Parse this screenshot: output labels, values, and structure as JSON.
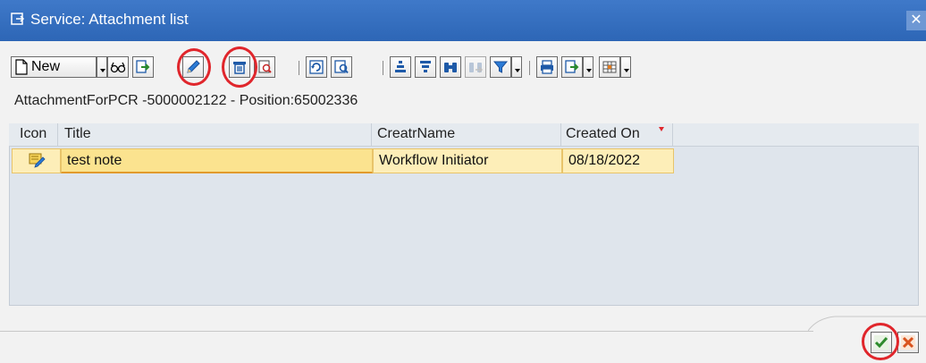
{
  "window": {
    "title": "Service: Attachment list",
    "close_icon": "close-icon"
  },
  "toolbar": {
    "new_label": "New",
    "buttons": [
      {
        "name": "new-button",
        "icon": "document-icon",
        "has_dropdown": true
      },
      {
        "name": "display-button",
        "icon": "glasses-icon"
      },
      {
        "name": "export-button",
        "icon": "export-icon"
      },
      {
        "name": "edit-button",
        "icon": "pencil-icon",
        "highlighted": true
      },
      {
        "name": "delete-button",
        "icon": "trash-icon",
        "highlighted": true
      },
      {
        "name": "details-button",
        "icon": "magnify-document-icon"
      },
      {
        "name": "refresh-button",
        "icon": "refresh-icon"
      },
      {
        "name": "select-layout-button",
        "icon": "find-icon"
      },
      {
        "name": "sort-ascending-button",
        "icon": "sort-ascending-icon"
      },
      {
        "name": "sort-descending-button",
        "icon": "sort-descending-icon"
      },
      {
        "name": "find-button",
        "icon": "binoculars-icon"
      },
      {
        "name": "find-next-button",
        "icon": "binoculars-next-icon",
        "disabled": true
      },
      {
        "name": "filter-button",
        "icon": "filter-icon",
        "has_dropdown": true
      },
      {
        "name": "print-button",
        "icon": "print-icon"
      },
      {
        "name": "export-list-button",
        "icon": "export-icon",
        "has_dropdown": true
      },
      {
        "name": "layout-button",
        "icon": "grid-icon",
        "has_dropdown": true
      }
    ],
    "highlight_color": "#e0262c"
  },
  "info": {
    "text": "AttachmentForPCR -5000002122 - Position:65002336"
  },
  "table": {
    "columns": [
      "Icon",
      "Title",
      "CreatrName",
      "Created On"
    ],
    "sorted_column": "Created On",
    "rows": [
      {
        "icon": "note-icon",
        "title": "test note",
        "creator": "Workflow Initiator",
        "created_on": "08/18/2022"
      }
    ],
    "row_color": "#fdeeb8"
  },
  "footer": {
    "confirm_icon": "checkmark-icon",
    "cancel_icon": "cancel-icon",
    "confirm_highlighted": true
  },
  "colors": {
    "titlebar": "#2d66b6",
    "accent_gold": "#e0b23a",
    "icon_blue": "#1e5aa8"
  }
}
